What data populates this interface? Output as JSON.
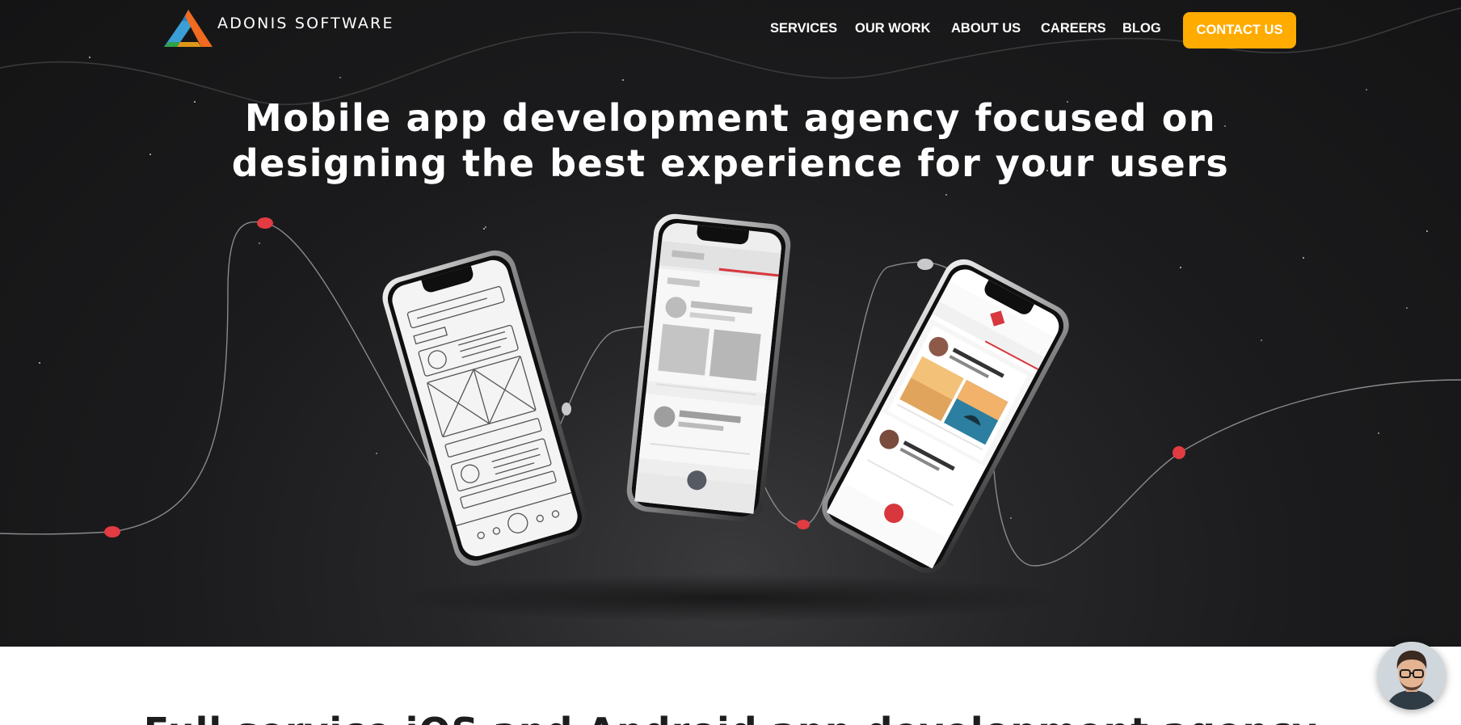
{
  "brand": {
    "name": "ADONIS SOFTWARE"
  },
  "nav": {
    "items": [
      {
        "label": "SERVICES"
      },
      {
        "label": "OUR WORK"
      },
      {
        "label": "ABOUT US"
      },
      {
        "label": "CAREERS"
      },
      {
        "label": "BLOG"
      }
    ],
    "cta_label": "CONTACT US"
  },
  "hero": {
    "headline_line1": "Mobile app development agency focused on",
    "headline_line2": "designing the best experience for your users"
  },
  "colors": {
    "accent": "#ffab00",
    "hero_background": "#1b1b1d",
    "marker_red": "#e23b41",
    "headline_text": "#ffffff"
  },
  "icons": [
    "logo-triangle-icon",
    "chat-avatar-icon"
  ],
  "next_section": {
    "title": "Full service iOS and Android app development agency"
  },
  "chat_widget": {
    "icon": "chat-avatar-icon"
  }
}
